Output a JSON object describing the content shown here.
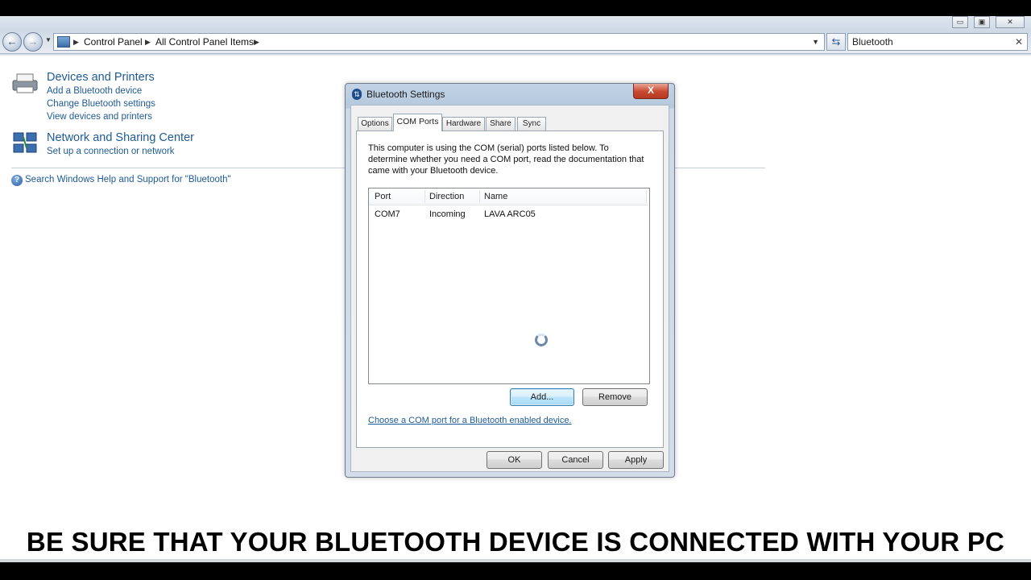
{
  "window": {
    "controls": [
      "▭",
      "▣",
      "✕"
    ]
  },
  "nav": {
    "back_icon": "back-arrow-icon",
    "forward_icon": "forward-arrow-icon",
    "breadcrumb": [
      "Control Panel",
      "All Control Panel Items"
    ],
    "search_value": "Bluetooth"
  },
  "results": {
    "devices": {
      "title": "Devices and Printers",
      "links": [
        "Add a Bluetooth device",
        "Change Bluetooth settings",
        "View devices and printers"
      ]
    },
    "network": {
      "title": "Network and Sharing Center",
      "links": [
        "Set up a connection or network"
      ]
    },
    "help_link": "Search Windows Help and Support for \"Bluetooth\""
  },
  "dialog": {
    "title": "Bluetooth Settings",
    "close_label": "X",
    "tabs": [
      "Options",
      "COM Ports",
      "Hardware",
      "Share",
      "Sync"
    ],
    "active_tab": "COM Ports",
    "description": "This computer is using the COM (serial) ports listed below. To determine whether you need a COM port, read the documentation that came with your Bluetooth device.",
    "columns": [
      "Port",
      "Direction",
      "Name"
    ],
    "rows": [
      {
        "port": "COM7",
        "direction": "Incoming",
        "name": "LAVA ARC05"
      }
    ],
    "add_label": "Add...",
    "remove_label": "Remove",
    "link": "Choose a COM port for a Bluetooth enabled device.",
    "ok_label": "OK",
    "cancel_label": "Cancel",
    "apply_label": "Apply"
  },
  "caption": "BE SURE THAT YOUR BLUETOOTH DEVICE IS CONNECTED WITH YOUR PC"
}
